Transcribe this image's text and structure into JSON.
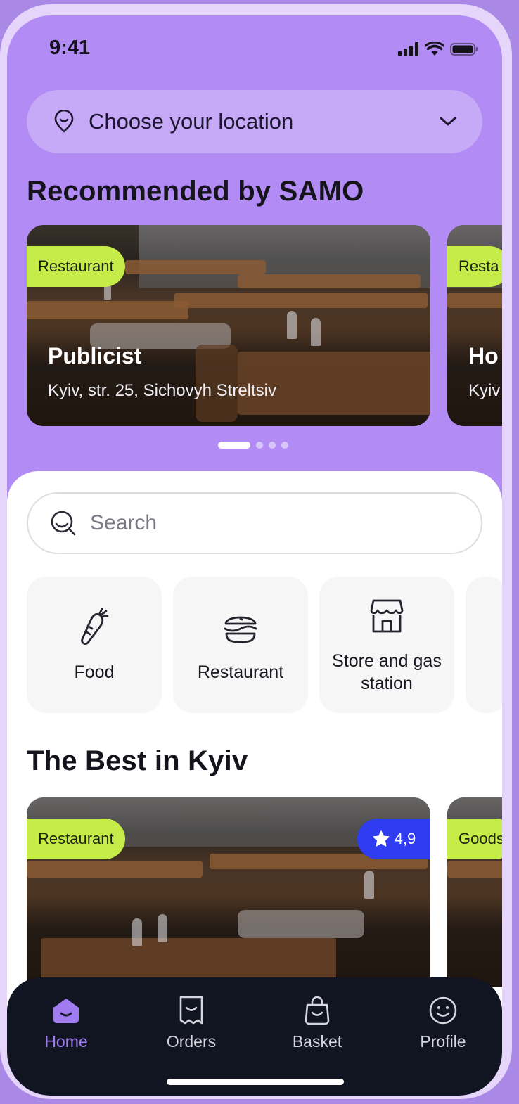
{
  "status_bar": {
    "time": "9:41",
    "icons": [
      "signal-icon",
      "wifi-icon",
      "battery-icon"
    ]
  },
  "location": {
    "label": "Choose your location",
    "icon": "location-pin-icon"
  },
  "recommended": {
    "title": "Recommended by SAMO",
    "cards": [
      {
        "badge": "Restaurant",
        "name": "Publicist",
        "address": "Kyiv, str. 25, Sichovyh Streltsiv"
      },
      {
        "badge": "Resta",
        "name": "Ho",
        "address": "Kyiv"
      }
    ],
    "pagination": {
      "count": 4,
      "active": 1
    }
  },
  "search": {
    "placeholder": "Search"
  },
  "categories": [
    {
      "label": "Food",
      "icon": "carrot-icon"
    },
    {
      "label": "Restaurant",
      "icon": "burger-icon"
    },
    {
      "label": "Store and gas station",
      "icon": "store-icon"
    }
  ],
  "best": {
    "title": "The Best in Kyiv",
    "cards": [
      {
        "badge": "Restaurant",
        "rating": "4,9"
      },
      {
        "badge": "Goods"
      }
    ]
  },
  "nav": {
    "items": [
      {
        "label": "Home",
        "icon": "home-icon",
        "active": true
      },
      {
        "label": "Orders",
        "icon": "receipt-icon",
        "active": false
      },
      {
        "label": "Basket",
        "icon": "bag-icon",
        "active": false
      },
      {
        "label": "Profile",
        "icon": "smile-icon",
        "active": false
      }
    ]
  },
  "colors": {
    "brand_purple": "#b28cf4",
    "badge_lime": "#c6ec4a",
    "rating_blue": "#2f3cf2",
    "nav_dark": "#111421",
    "nav_active": "#a07cf0"
  }
}
